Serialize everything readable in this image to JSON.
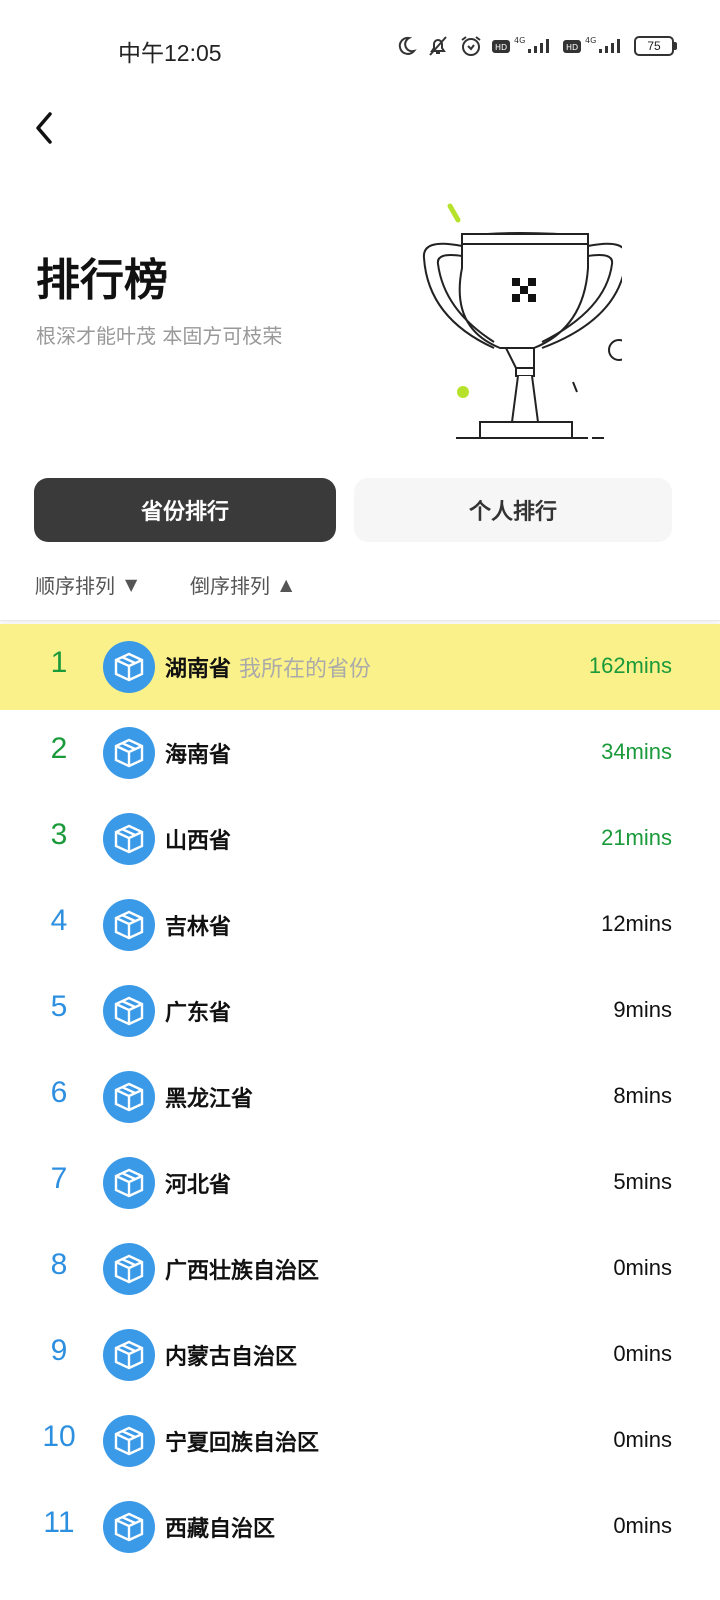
{
  "status": {
    "time": "中午12:05",
    "battery": "75"
  },
  "header": {
    "title": "排行榜",
    "subtitle": "根深才能叶茂 本固方可枝荣"
  },
  "tabs": [
    {
      "label": "省份排行"
    },
    {
      "label": "个人排行"
    }
  ],
  "sort": {
    "asc_label": "顺序排列",
    "asc_arrow": "▼",
    "desc_label": "倒序排列",
    "desc_arrow": "▲"
  },
  "current_note": "我所在的省份",
  "rows": [
    {
      "rank": "1",
      "name": "湖南省",
      "time": "162mins"
    },
    {
      "rank": "2",
      "name": "海南省",
      "time": "34mins"
    },
    {
      "rank": "3",
      "name": "山西省",
      "time": "21mins"
    },
    {
      "rank": "4",
      "name": "吉林省",
      "time": "12mins"
    },
    {
      "rank": "5",
      "name": "广东省",
      "time": "9mins"
    },
    {
      "rank": "6",
      "name": "黑龙江省",
      "time": "8mins"
    },
    {
      "rank": "7",
      "name": "河北省",
      "time": "5mins"
    },
    {
      "rank": "8",
      "name": "广西壮族自治区",
      "time": "0mins"
    },
    {
      "rank": "9",
      "name": "内蒙古自治区",
      "time": "0mins"
    },
    {
      "rank": "10",
      "name": "宁夏回族自治区",
      "time": "0mins"
    },
    {
      "rank": "11",
      "name": "西藏自治区",
      "time": "0mins"
    }
  ],
  "colors": {
    "top_rank": "#1a9a3a",
    "rank": "#2d8fe0",
    "highlight": "#fbf18a",
    "avatar": "#3b9ae8"
  },
  "icons": {
    "back": "chevron-left-icon",
    "avatar": "cube-icon",
    "trophy": "trophy-illustration"
  }
}
